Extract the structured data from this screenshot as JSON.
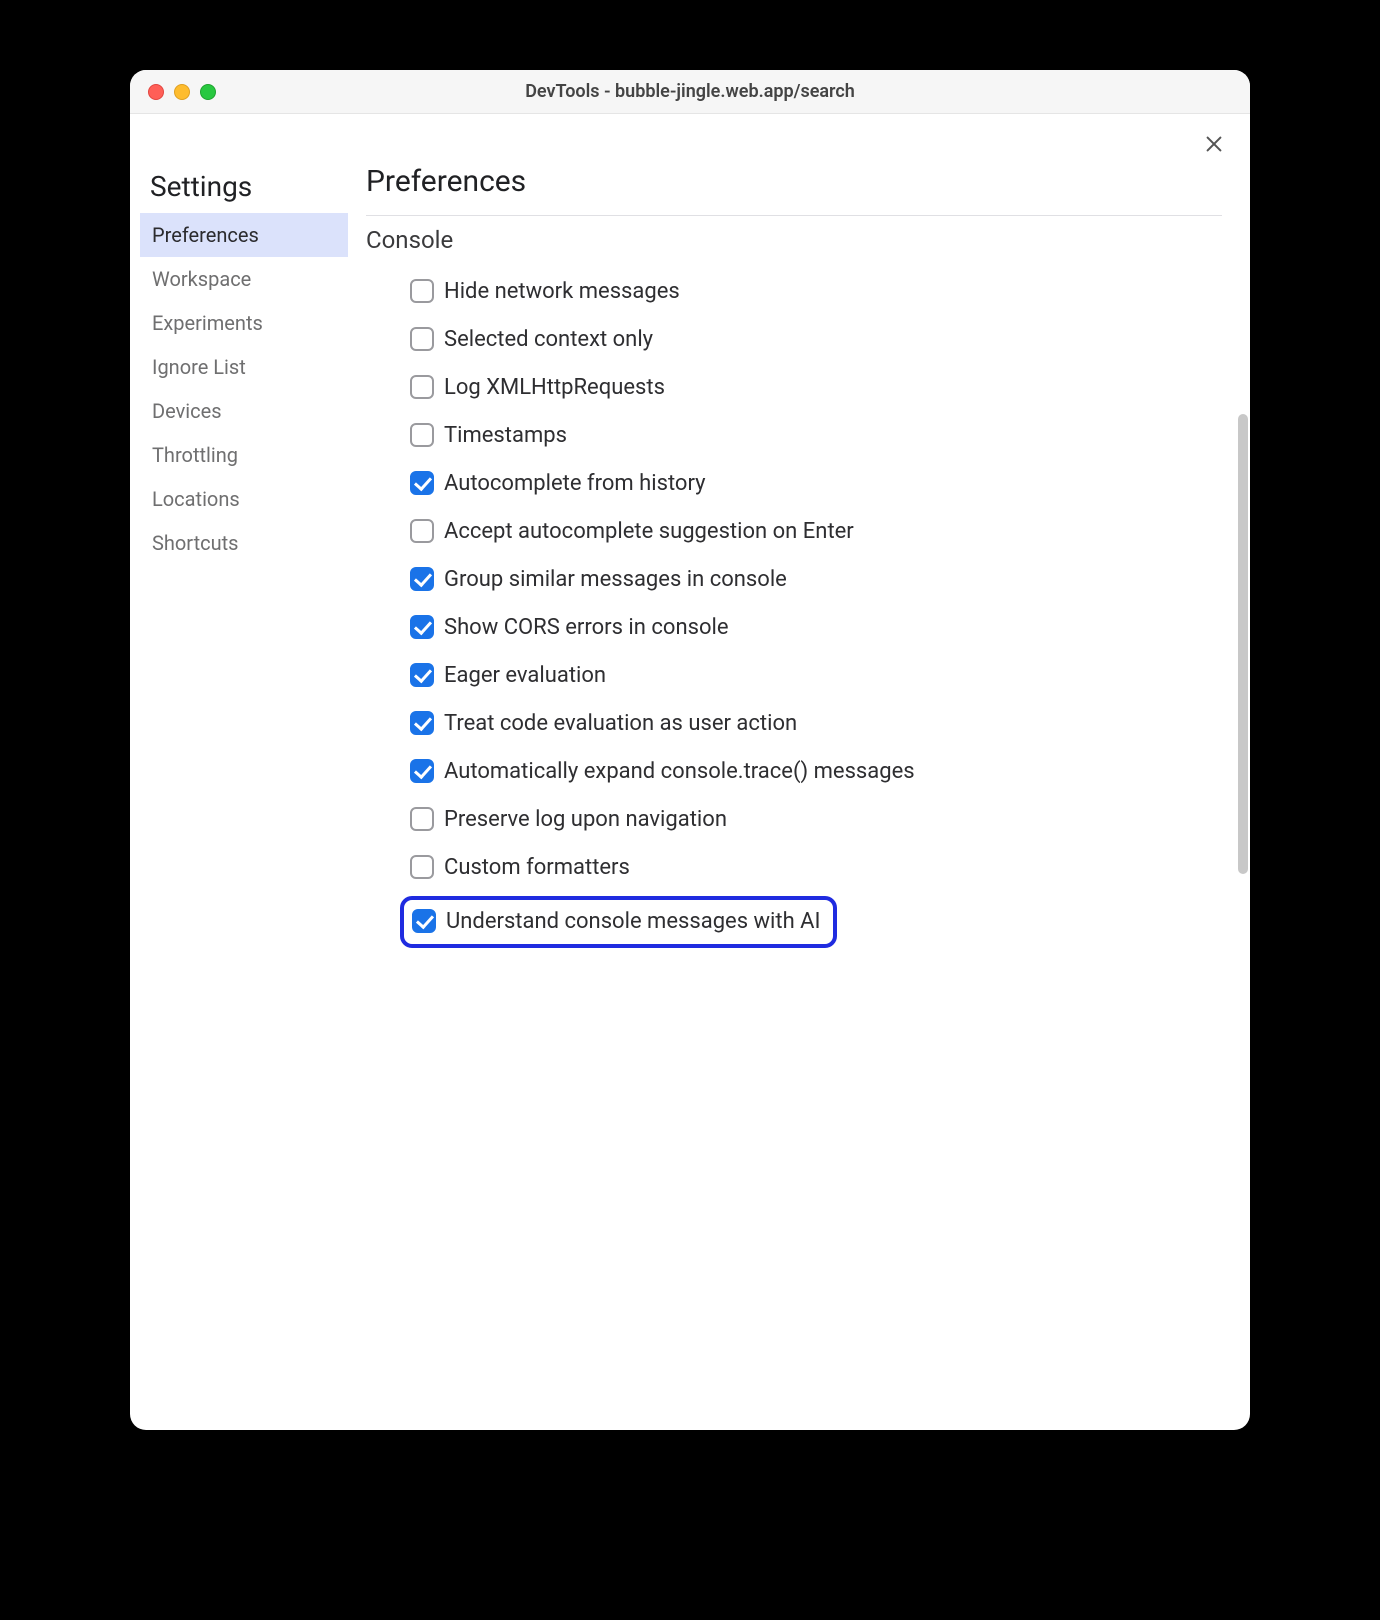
{
  "window": {
    "title": "DevTools - bubble-jingle.web.app/search"
  },
  "sidebar": {
    "title": "Settings",
    "items": [
      {
        "label": "Preferences",
        "active": true
      },
      {
        "label": "Workspace",
        "active": false
      },
      {
        "label": "Experiments",
        "active": false
      },
      {
        "label": "Ignore List",
        "active": false
      },
      {
        "label": "Devices",
        "active": false
      },
      {
        "label": "Throttling",
        "active": false
      },
      {
        "label": "Locations",
        "active": false
      },
      {
        "label": "Shortcuts",
        "active": false
      }
    ]
  },
  "main": {
    "title": "Preferences",
    "section": "Console",
    "options": [
      {
        "label": "Hide network messages",
        "checked": false
      },
      {
        "label": "Selected context only",
        "checked": false
      },
      {
        "label": "Log XMLHttpRequests",
        "checked": false
      },
      {
        "label": "Timestamps",
        "checked": false
      },
      {
        "label": "Autocomplete from history",
        "checked": true
      },
      {
        "label": "Accept autocomplete suggestion on Enter",
        "checked": false
      },
      {
        "label": "Group similar messages in console",
        "checked": true
      },
      {
        "label": "Show CORS errors in console",
        "checked": true
      },
      {
        "label": "Eager evaluation",
        "checked": true
      },
      {
        "label": "Treat code evaluation as user action",
        "checked": true
      },
      {
        "label": "Automatically expand console.trace() messages",
        "checked": true
      },
      {
        "label": "Preserve log upon navigation",
        "checked": false
      },
      {
        "label": "Custom formatters",
        "checked": false
      },
      {
        "label": "Understand console messages with AI",
        "checked": true,
        "highlighted": true
      }
    ]
  },
  "colors": {
    "accent": "#1a73e8",
    "highlight_border": "#1f2be0",
    "sidebar_active_bg": "#dbe2fb"
  }
}
